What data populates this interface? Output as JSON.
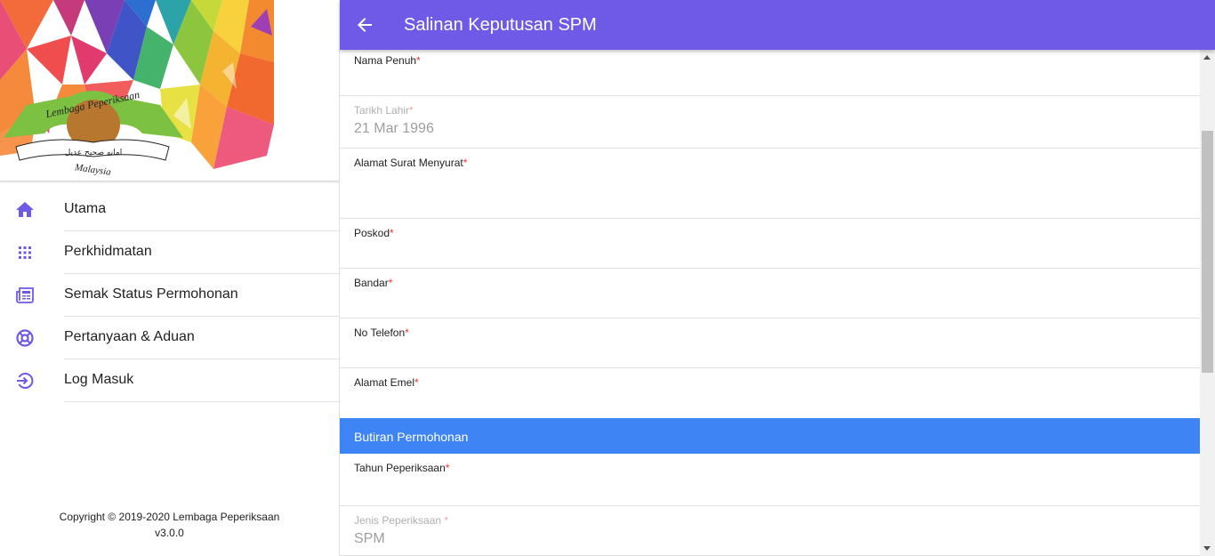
{
  "banner": {
    "logo_text": "Lembaga Peperiksaan Malaysia",
    "logo_motto": "امانه صحيح عديل"
  },
  "sidebar": {
    "items": [
      {
        "label": "Utama",
        "icon": "home-icon"
      },
      {
        "label": "Perkhidmatan",
        "icon": "apps-grid-icon"
      },
      {
        "label": "Semak Status Permohonan",
        "icon": "newspaper-icon"
      },
      {
        "label": "Pertanyaan & Aduan",
        "icon": "lifebuoy-icon"
      },
      {
        "label": "Log Masuk",
        "icon": "login-icon"
      }
    ],
    "footer": {
      "copyright": "Copyright © 2019-2020 Lembaga Peperiksaan",
      "version": "v3.0.0"
    }
  },
  "appbar": {
    "title": "Salinan Keputusan SPM",
    "color": "#6e5ae6"
  },
  "form": {
    "fields": [
      {
        "label": "Nama Penuh",
        "required": "*",
        "value": "",
        "disabled": false
      },
      {
        "label": "Tarikh Lahir",
        "required": "*",
        "value": "21 Mar 1996",
        "disabled": true
      },
      {
        "label": "Alamat Surat Menyurat",
        "required": "*",
        "value": "",
        "disabled": false
      },
      {
        "label": "Poskod",
        "required": "*",
        "value": "",
        "disabled": false
      },
      {
        "label": "Bandar",
        "required": "*",
        "value": "",
        "disabled": false
      },
      {
        "label": "No Telefon",
        "required": "*",
        "value": "",
        "disabled": false
      },
      {
        "label": "Alamat Emel",
        "required": "*",
        "value": "",
        "disabled": false
      }
    ],
    "section_title": "Butiran Permohonan",
    "section_color": "#3f84f4",
    "fields2": [
      {
        "label": "Tahun Peperiksaan",
        "required": "*",
        "value": "",
        "disabled": false
      },
      {
        "label": "Jenis Peperiksaan ",
        "required": "*",
        "value": "SPM",
        "disabled": true
      }
    ]
  }
}
